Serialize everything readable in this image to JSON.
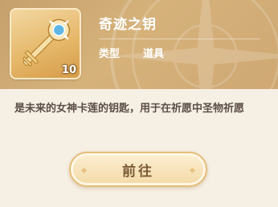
{
  "item": {
    "name": "奇迹之钥",
    "quantity": "10",
    "type_label": "类型",
    "type_value": "道具",
    "icon": "golden-key-icon"
  },
  "description": "是未来的女神卡莲的钥匙，用于在祈愿中圣物祈愿",
  "action": {
    "goto_label": "前往"
  },
  "colors": {
    "header": "#cfa873",
    "panel": "#f6efe4",
    "button": "#f3d9a6",
    "button_text": "#7a5a34",
    "desc_text": "#5b4f47"
  }
}
